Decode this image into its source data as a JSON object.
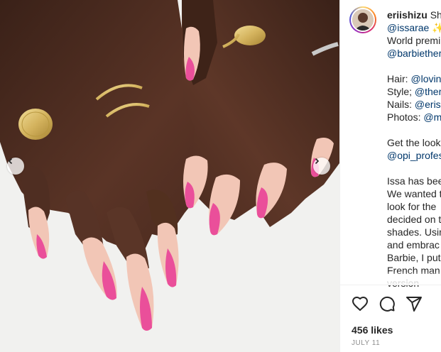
{
  "post": {
    "username": "eriishizu",
    "header_suffix": "Sh",
    "caption_lines": [
      {
        "text": "@issarae ✨",
        "kind": "link"
      },
      {
        "text": "World premi",
        "kind": "text"
      },
      {
        "text": "@barbiether",
        "kind": "link"
      },
      {
        "text": "",
        "kind": "blank"
      },
      {
        "label": "Hair: ",
        "text": "@lovin",
        "kind": "labeled"
      },
      {
        "label": "Style; ",
        "text": "@ther",
        "kind": "labeled"
      },
      {
        "label": "Nails: ",
        "text": "@erisl",
        "kind": "labeled"
      },
      {
        "label": "Photos: ",
        "text": "@m",
        "kind": "labeled"
      },
      {
        "text": "",
        "kind": "blank"
      },
      {
        "text": "Get the look",
        "kind": "text"
      },
      {
        "text": "@opi_profes",
        "kind": "link"
      },
      {
        "text": "",
        "kind": "blank"
      },
      {
        "text": "Issa has bee",
        "kind": "text"
      },
      {
        "text": "We wanted t",
        "kind": "text"
      },
      {
        "text": "look for the",
        "kind": "text"
      },
      {
        "text": "decided on t",
        "kind": "text"
      },
      {
        "text": "shades. Usin",
        "kind": "text"
      },
      {
        "text": "and embrac",
        "kind": "text"
      },
      {
        "text": "Barbie, I put",
        "kind": "text"
      },
      {
        "text": "French man",
        "kind": "text"
      },
      {
        "text": "version",
        "kind": "text"
      }
    ],
    "likes": "456 likes",
    "date": "JULY 11"
  },
  "actions": {
    "like_icon": "heart-icon",
    "comment_icon": "comment-icon",
    "share_icon": "share-icon"
  },
  "carousel": {
    "prev_icon": "chevron-left-icon",
    "next_icon": "chevron-right-icon"
  },
  "colors": {
    "skin": "#4a2a1f",
    "nail_base": "#f2c6b6",
    "nail_pink": "#ea4f9a",
    "gold": "#d4b35e",
    "link": "#00376b"
  }
}
